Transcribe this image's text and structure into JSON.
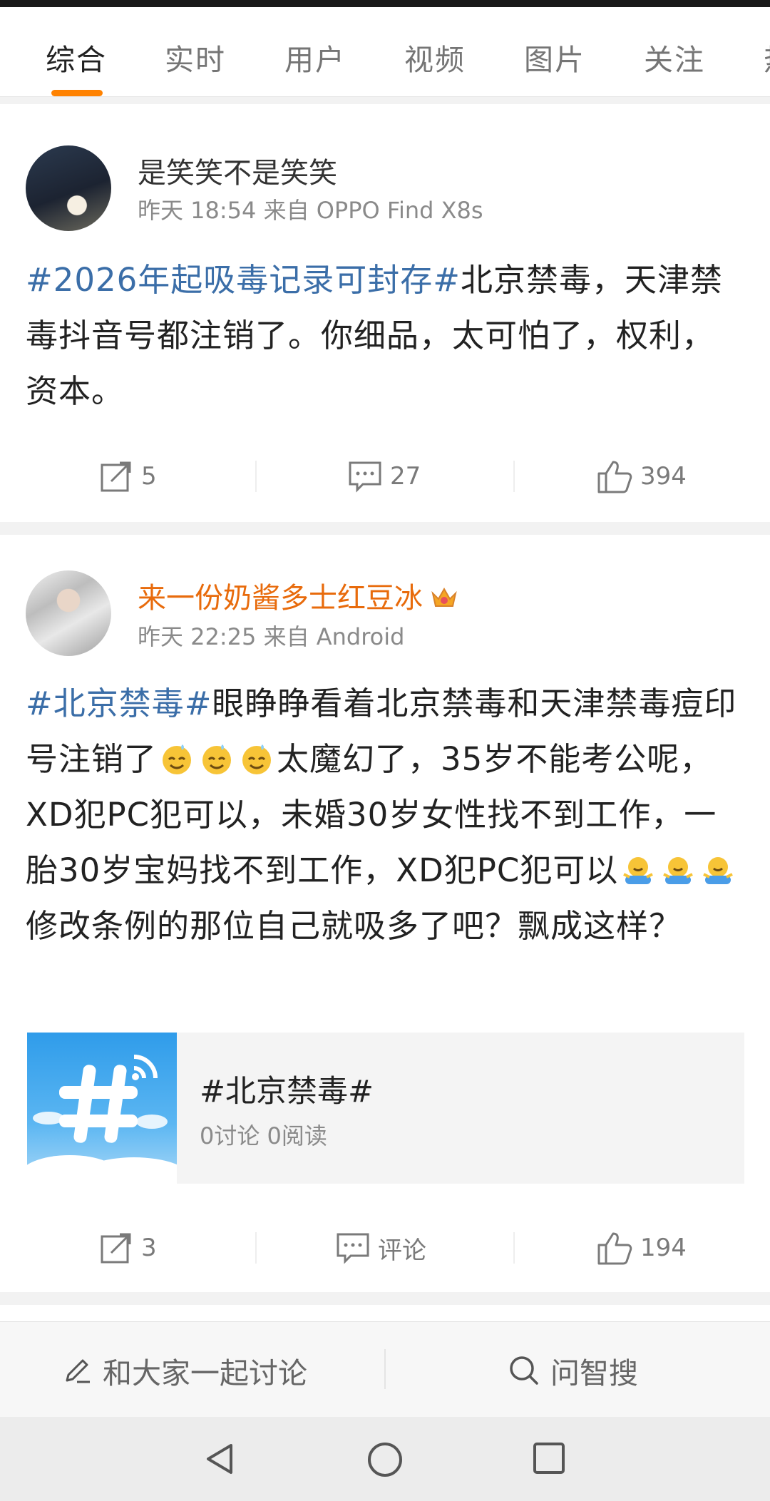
{
  "tabs": [
    "综合",
    "实时",
    "用户",
    "视频",
    "图片",
    "关注",
    "热"
  ],
  "posts": [
    {
      "username": "是笑笑不是笑笑",
      "meta": "昨天 18:54 来自 OPPO Find X8s",
      "text_tag": "#2026年起吸毒记录可封存#",
      "text_body": "北京禁毒，天津禁毒抖音号都注销了。你细品，太可怕了，权利，资本。",
      "repost_count": "5",
      "comment_label": "27",
      "like_count": "394"
    },
    {
      "username": "来一份奶酱多士红豆冰",
      "meta": "昨天 22:25 来自 Android",
      "text_tag": "#北京禁毒#",
      "text_part1": "眼睁睁看着北京禁毒和天津禁毒痘印号注销了",
      "text_part2": "太魔幻了，35岁不能考公呢，XD犯PC犯可以，未婚30岁女性找不到工作，一胎30岁宝妈找不到工作，XD犯PC犯可以",
      "text_part3": "修改条例的那位自己就吸多了吧？飘成这样？",
      "topic_title": "#北京禁毒#",
      "topic_stats": "0讨论 0阅读",
      "repost_count": "3",
      "comment_label": "评论",
      "like_count": "194"
    }
  ],
  "bottom_bar": {
    "discuss_label": "和大家一起讨论",
    "search_label": "问智搜"
  },
  "colors": {
    "accent": "#ff8200",
    "hashtag": "#3b6ea8",
    "vip_name": "#e86b0c"
  }
}
